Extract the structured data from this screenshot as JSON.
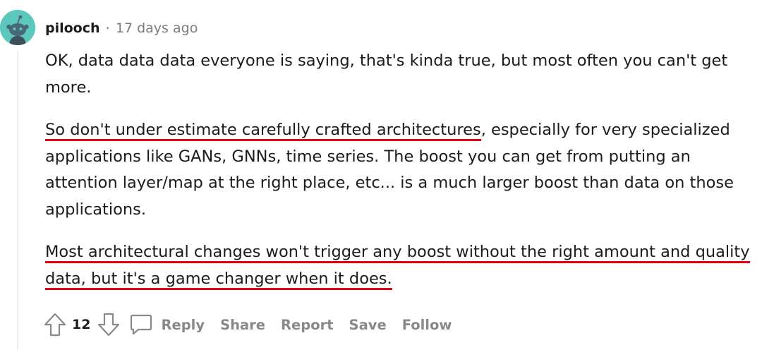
{
  "comment": {
    "username": "pilooch",
    "separator": "·",
    "time": "17 days ago",
    "paragraphs": {
      "p1": "OK, data data data everyone is saying, that's kinda true, but most often you can't get more.",
      "p2_highlight": "So don't under estimate carefully crafted architectures",
      "p2_rest": ", especially for very specialized applications like GANs, GNNs, time series. The boost you can get from putting an attention layer/map at the right place, etc... is a much larger boost than data on those applications.",
      "p3_highlight": "Most architectural changes won't trigger any boost without the right amount and quality data, but it's a game changer when it does."
    },
    "actions": {
      "score": "12",
      "reply": "Reply",
      "share": "Share",
      "report": "Report",
      "save": "Save",
      "follow": "Follow"
    }
  },
  "colors": {
    "avatar_bg": "#5bc8bd",
    "highlight_underline": "#e3000f",
    "muted_text": "#878a8c"
  },
  "icons": {
    "avatar": "snoo-avatar-icon",
    "upvote": "upvote-arrow-icon",
    "downvote": "downvote-arrow-icon",
    "reply": "comment-bubble-icon"
  }
}
